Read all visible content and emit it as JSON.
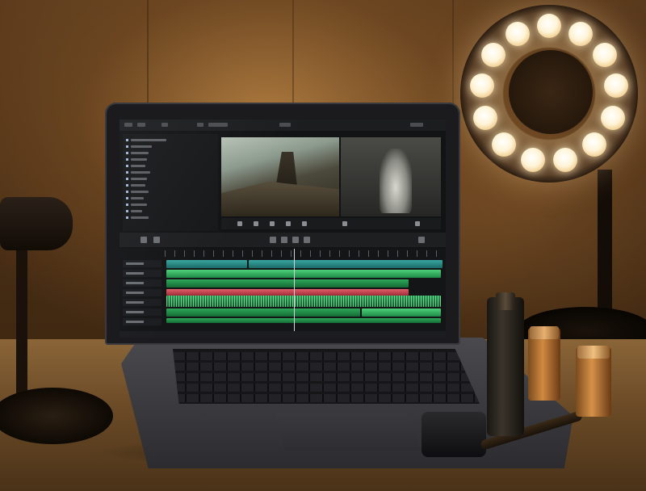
{
  "scene": {
    "description_tags": [
      "laptop-video-editor",
      "ring-light",
      "bottles",
      "desk"
    ],
    "colors": {
      "wall": "#6b4524",
      "desk": "#7a5830",
      "laptop": "#1b1b1d",
      "ring_light_glow": "#fff4d8",
      "clip_green": "#4fd07a",
      "clip_red": "#e0606a"
    },
    "ring_light": {
      "bulb_count": 13
    }
  }
}
